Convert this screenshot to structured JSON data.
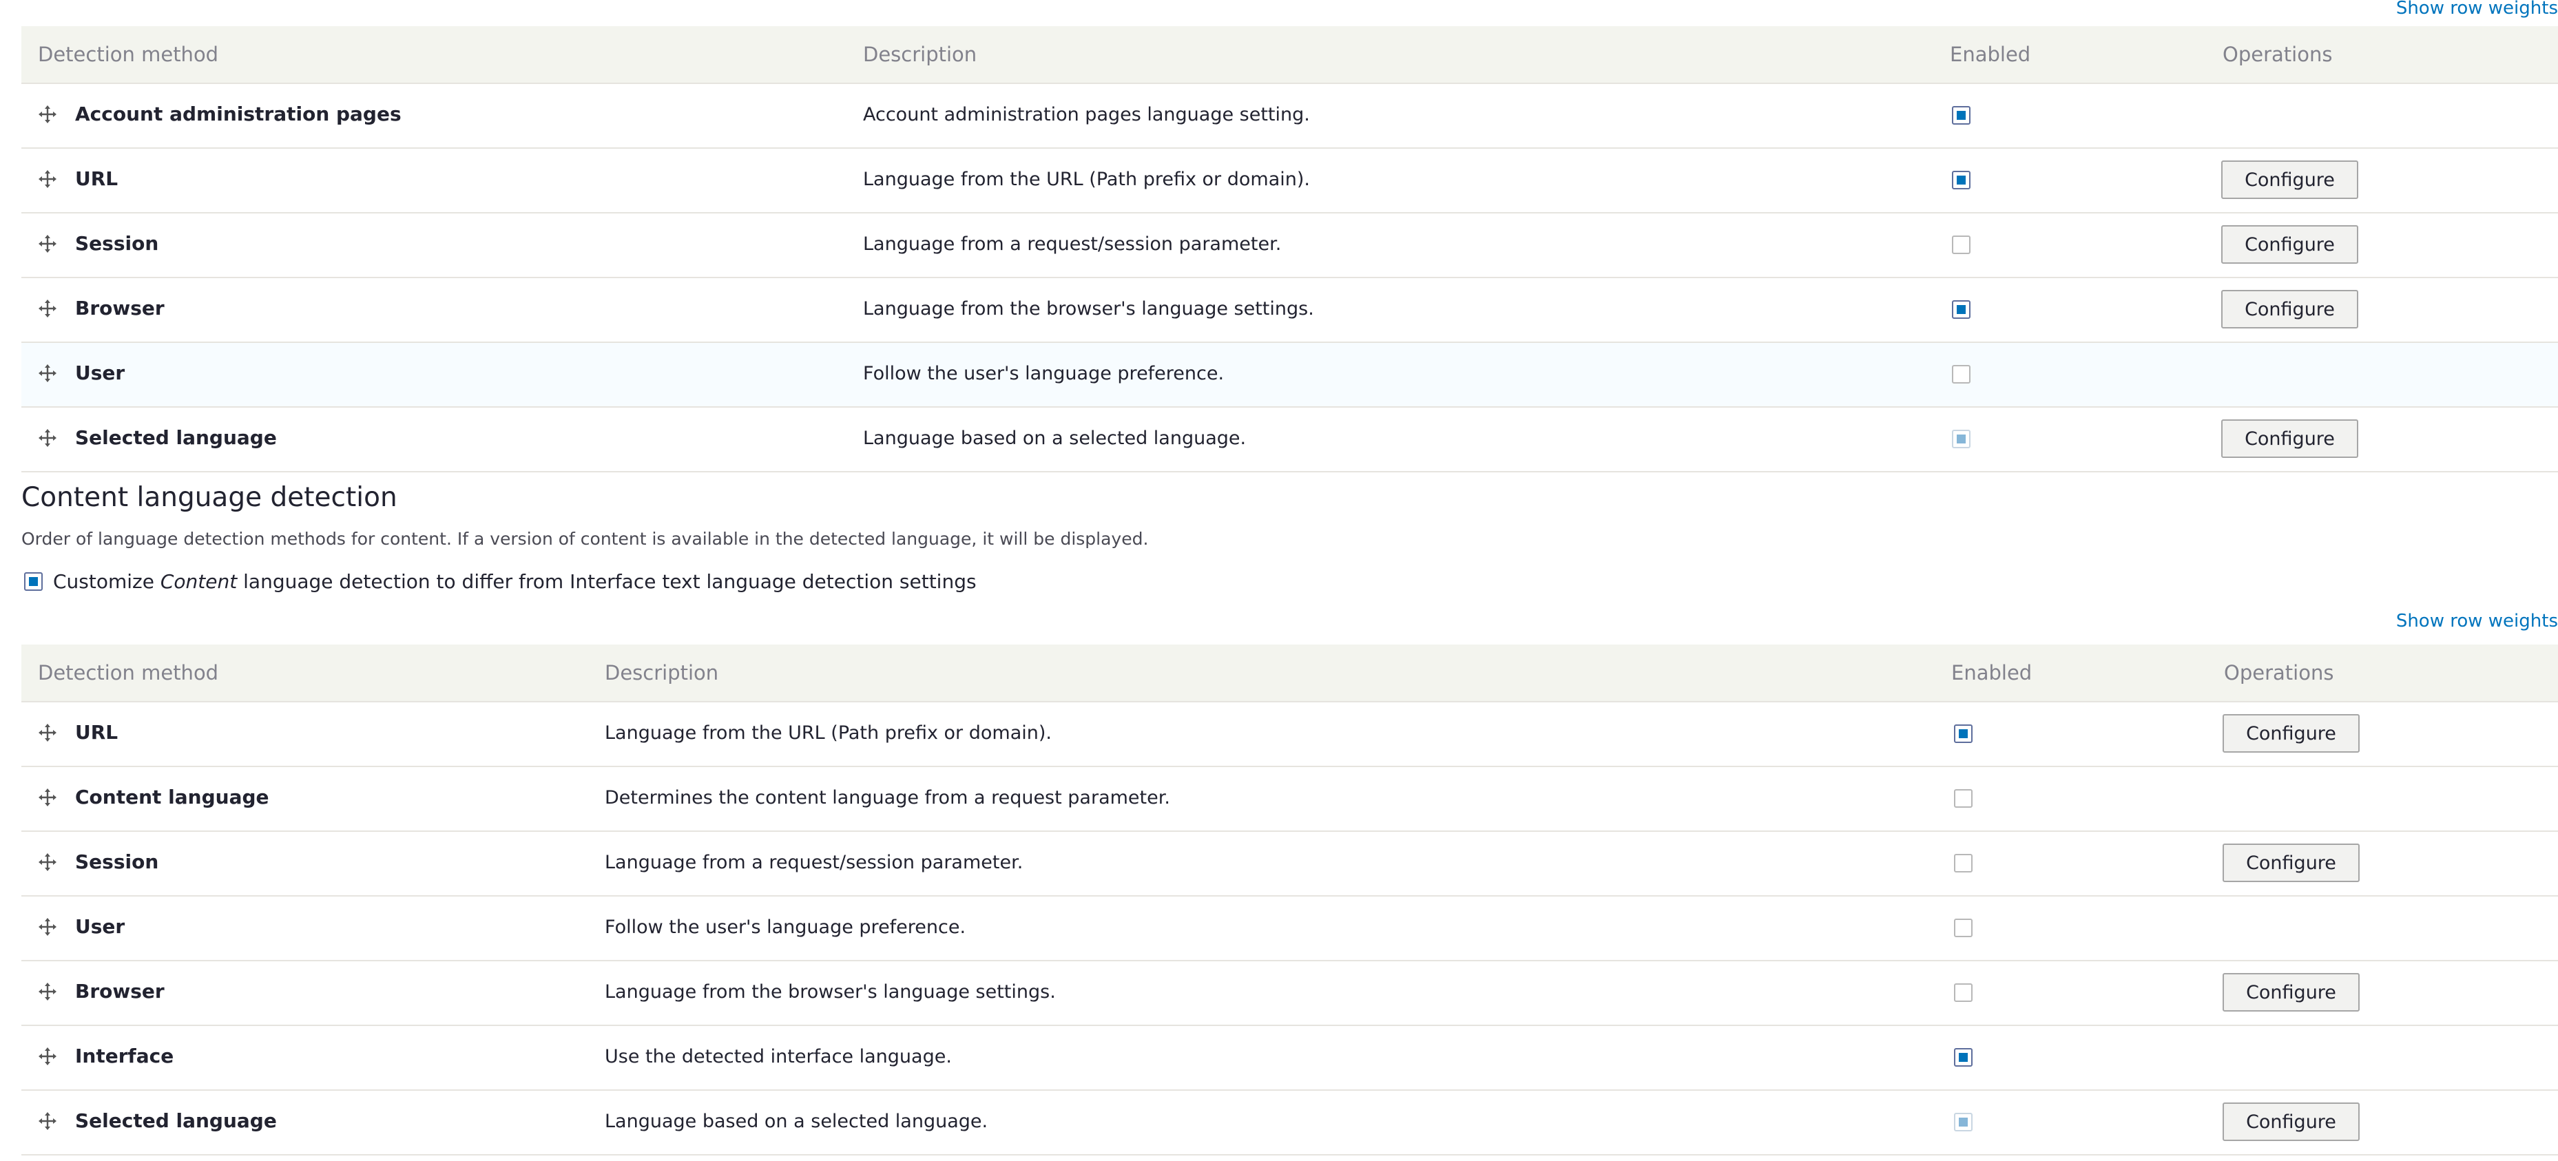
{
  "show_row_weights": "Show row weights",
  "columns": {
    "method": "Detection method",
    "description": "Description",
    "enabled": "Enabled",
    "operations": "Operations"
  },
  "icons": {
    "drag_handle": "drag-handle-icon",
    "checkbox": "checkbox"
  },
  "colors": {
    "link": "#0074bd",
    "checkbox_on": "#0073ba",
    "header_bg": "#f3f4ee",
    "hover_row": "#f7fcff"
  },
  "interface_table": {
    "rows": [
      {
        "method": "Account administration pages",
        "description": "Account administration pages language setting.",
        "enabled": true,
        "configure": ""
      },
      {
        "method": "URL",
        "description": "Language from the URL (Path prefix or domain).",
        "enabled": true,
        "configure": "Configure"
      },
      {
        "method": "Session",
        "description": "Language from a request/session parameter.",
        "enabled": false,
        "configure": "Configure"
      },
      {
        "method": "Browser",
        "description": "Language from the browser's language settings.",
        "enabled": true,
        "configure": "Configure"
      },
      {
        "method": "User",
        "description": "Follow the user's language preference.",
        "enabled": false,
        "configure": ""
      },
      {
        "method": "Selected language",
        "description": "Language based on a selected language.",
        "enabled": true,
        "disabled": true,
        "configure": "Configure"
      }
    ]
  },
  "content_section": {
    "title": "Content language detection",
    "description": "Order of language detection methods for content. If a version of content is available in the detected language, it will be displayed.",
    "customize_prefix": "Customize ",
    "customize_em": "Content",
    "customize_suffix": " language detection to differ from Interface text language detection settings",
    "customize_checked": true
  },
  "content_table": {
    "rows": [
      {
        "method": "URL",
        "description": "Language from the URL (Path prefix or domain).",
        "enabled": true,
        "configure": "Configure"
      },
      {
        "method": "Content language",
        "description": "Determines the content language from a request parameter.",
        "enabled": false,
        "configure": ""
      },
      {
        "method": "Session",
        "description": "Language from a request/session parameter.",
        "enabled": false,
        "configure": "Configure"
      },
      {
        "method": "User",
        "description": "Follow the user's language preference.",
        "enabled": false,
        "configure": ""
      },
      {
        "method": "Browser",
        "description": "Language from the browser's language settings.",
        "enabled": false,
        "configure": "Configure"
      },
      {
        "method": "Interface",
        "description": "Use the detected interface language.",
        "enabled": true,
        "configure": ""
      },
      {
        "method": "Selected language",
        "description": "Language based on a selected language.",
        "enabled": true,
        "disabled": true,
        "configure": "Configure"
      }
    ]
  }
}
